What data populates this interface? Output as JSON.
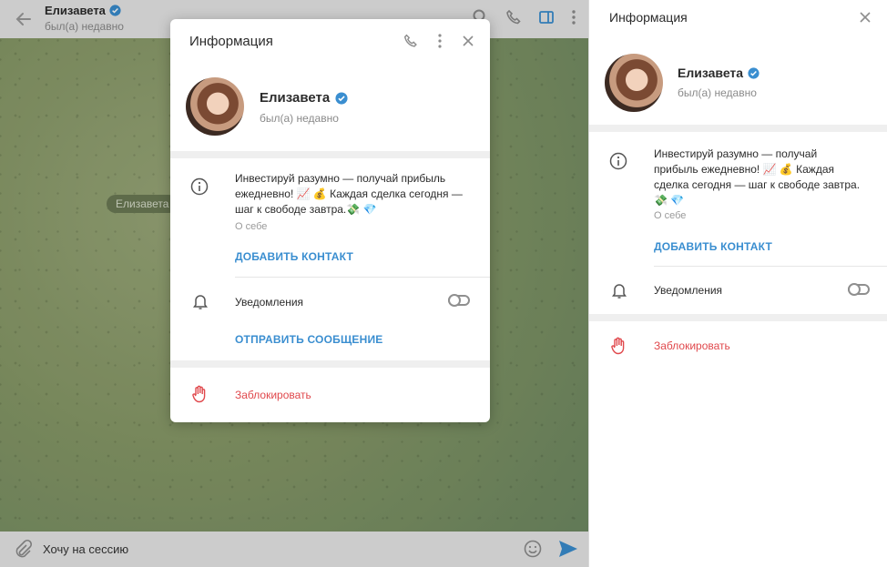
{
  "chat": {
    "contact_name": "Елизавета",
    "contact_status": "был(а) недавно",
    "name_pill": "Елизавета",
    "input_text": "Хочу на сессию"
  },
  "modal": {
    "title": "Информация",
    "name": "Елизавета",
    "status": "был(а) недавно",
    "bio_lines": [
      "Инвестируй разумно — получай прибыль",
      "ежедневно! 📈 💰 Каждая сделка сегодня —",
      "шаг к свободе завтра.💸 💎"
    ],
    "bio_label": "О себе",
    "add_contact": "ДОБАВИТЬ КОНТАКТ",
    "notifications": "Уведомления",
    "send_message": "ОТПРАВИТЬ СООБЩЕНИЕ",
    "block": "Заблокировать",
    "notifications_on": false
  },
  "side": {
    "title": "Информация",
    "name": "Елизавета",
    "status": "был(а) недавно",
    "bio_lines": [
      "Инвестируй разумно — получай",
      "прибыль ежедневно! 📈 💰 Каждая",
      "сделка сегодня — шаг к свободе завтра.",
      "💸 💎"
    ],
    "bio_label": "О себе",
    "add_contact": "ДОБАВИТЬ КОНТАКТ",
    "notifications": "Уведомления",
    "block": "Заблокировать",
    "notifications_on": false
  },
  "colors": {
    "accent": "#3a8ed0",
    "verified": "#3a8ed0",
    "danger": "#e0484c"
  }
}
